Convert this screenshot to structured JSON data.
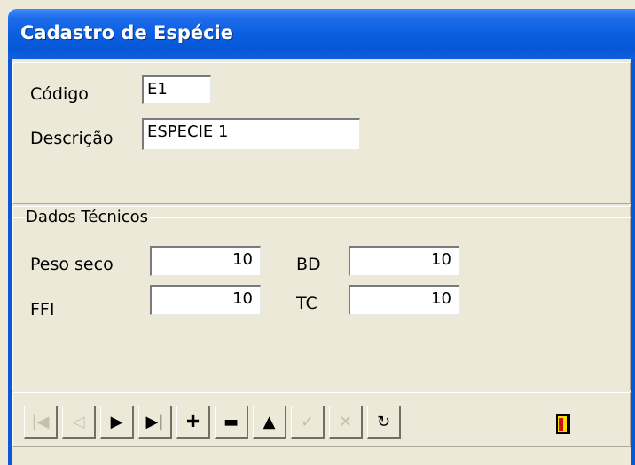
{
  "window": {
    "title": "Cadastro de Espécie"
  },
  "form": {
    "codigo_label": "Código",
    "codigo_value": "E1",
    "descricao_label": "Descrição",
    "descricao_value": "ESPECIE 1"
  },
  "dados_tecnicos": {
    "group_title": "Dados Técnicos",
    "peso_seco_label": "Peso seco",
    "peso_seco_value": "10",
    "bd_label": "BD",
    "bd_value": "10",
    "ffi_label": "FFI",
    "ffi_value": "10",
    "tc_label": "TC",
    "tc_value": "10"
  },
  "navigator": {
    "buttons": [
      {
        "name": "first",
        "icon": "first-record-icon",
        "glyph": "|◀",
        "enabled": false
      },
      {
        "name": "prior",
        "icon": "prior-record-icon",
        "glyph": "◁",
        "enabled": false
      },
      {
        "name": "next",
        "icon": "next-record-icon",
        "glyph": "▶",
        "enabled": true
      },
      {
        "name": "last",
        "icon": "last-record-icon",
        "glyph": "▶|",
        "enabled": true
      },
      {
        "name": "insert",
        "icon": "plus-icon",
        "glyph": "✚",
        "enabled": true
      },
      {
        "name": "delete",
        "icon": "minus-icon",
        "glyph": "▬",
        "enabled": true
      },
      {
        "name": "edit",
        "icon": "edit-up-icon",
        "glyph": "▲",
        "enabled": true
      },
      {
        "name": "post",
        "icon": "checkmark-icon",
        "glyph": "✓",
        "enabled": false
      },
      {
        "name": "cancel",
        "icon": "cross-icon",
        "glyph": "✕",
        "enabled": false
      },
      {
        "name": "refresh",
        "icon": "refresh-icon",
        "glyph": "↻",
        "enabled": true
      }
    ],
    "exit_icon": "exit-door-icon"
  },
  "colors": {
    "titlebar": "#0a5fe0",
    "face": "#ece9d8",
    "exit_door_yellow": "#f5e000",
    "exit_door_red": "#d01010"
  }
}
